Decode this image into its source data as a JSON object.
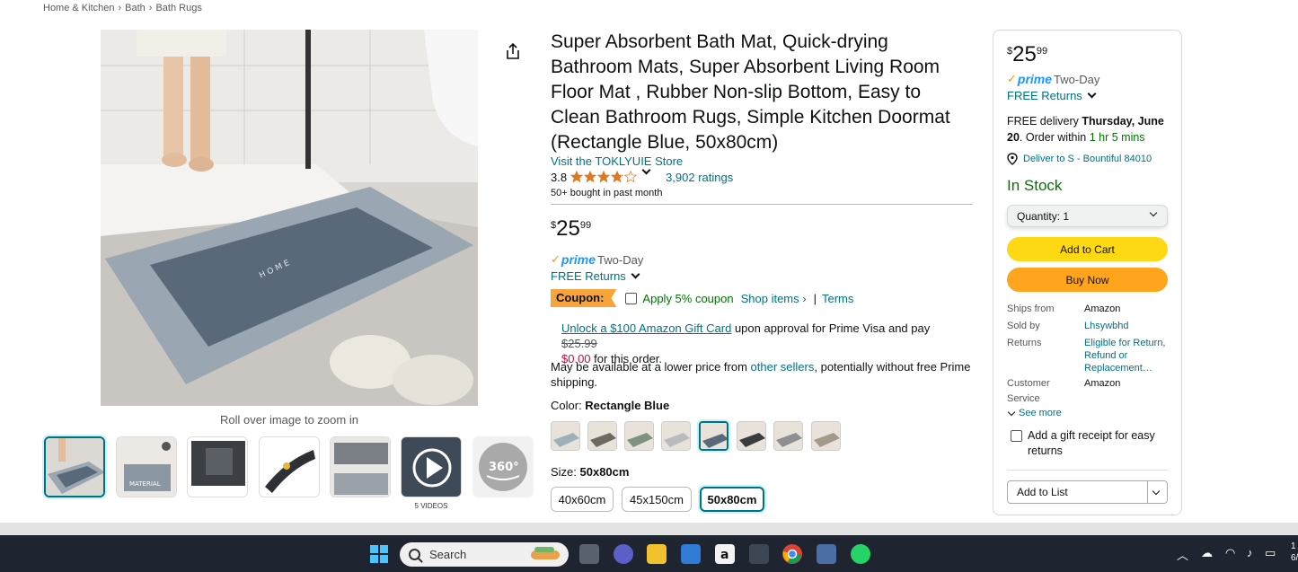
{
  "breadcrumb": [
    "Home & Kitchen",
    "Bath",
    "Bath Rugs"
  ],
  "image": {
    "zoom_hint": "Roll over image to zoom in",
    "mat_text": "H O M E",
    "videos_label": "5 VIDEOS",
    "thumb_360": "360°",
    "thumb_material": "MATERIAL"
  },
  "product": {
    "title": "Super Absorbent Bath Mat, Quick-drying Bathroom Mats, Super Absorbent Living Room Floor Mat , Rubber Non-slip Bottom, Easy to Clean Bathroom Rugs, Simple Kitchen Doormat (Rectangle Blue, 50x80cm)",
    "store_link": "Visit the TOKLYUIE Store",
    "rating": "3.8",
    "rating_stars": 3.8,
    "ratings_count": "3,902 ratings",
    "bought": "50+ bought in past month",
    "price": {
      "symbol": "$",
      "whole": "25",
      "fraction": "99"
    },
    "prime": {
      "word": "prime",
      "label": "Two-Day"
    },
    "free_returns": "FREE Returns",
    "coupon": {
      "badge": "Coupon:",
      "text": "Apply 5% coupon",
      "shop_items": "Shop items ›",
      "sep": "|",
      "terms": "Terms"
    },
    "gift_card": {
      "link": "Unlock a $100 Amazon Gift Card",
      "text1": " upon approval for Prime Visa and pay ",
      "strike": "$25.99",
      "red": "$0.00",
      "text2": " for this order."
    },
    "lower_price": {
      "text1": "May be available at a lower price from ",
      "link": "other sellers",
      "text2": ", potentially without free Prime shipping."
    },
    "color": {
      "label": "Color: ",
      "value": "Rectangle Blue"
    },
    "size": {
      "label": "Size: ",
      "value": "50x80cm",
      "options": [
        "40x60cm",
        "45x150cm",
        "50x80cm"
      ]
    }
  },
  "buybox": {
    "price": {
      "symbol": "$",
      "whole": "25",
      "fraction": "99"
    },
    "prime": {
      "word": "prime",
      "label": "Two-Day"
    },
    "free_returns": "FREE Returns",
    "delivery": {
      "prefix": "FREE delivery ",
      "date": "Thursday, June 20",
      "mid": ". Order within ",
      "time": "1 hr 5 mins"
    },
    "deliver_to": "Deliver to S - Bountiful 84010",
    "stock": "In Stock",
    "quantity": "Quantity:  1",
    "add_to_cart": "Add to Cart",
    "buy_now": "Buy Now",
    "info": [
      {
        "key": "Ships from",
        "value": "Amazon"
      },
      {
        "key": "Sold by",
        "value": "Lhsywbhd"
      },
      {
        "key": "Returns",
        "value": "Eligible for Return, Refund or Replacement…"
      },
      {
        "key": "Customer Service",
        "value": "Amazon"
      }
    ],
    "see_more": "See more",
    "gift_receipt": "Add a gift receipt for easy returns",
    "add_to_list": "Add to List"
  },
  "taskbar": {
    "search": "Search",
    "clock": "1",
    "date": "6/"
  },
  "colors": {
    "link": "#007185",
    "prime": "#1a98ff",
    "cart": "#ffd814",
    "buy": "#ffa41c",
    "stock": "#007600",
    "accent": "#ff9900"
  }
}
